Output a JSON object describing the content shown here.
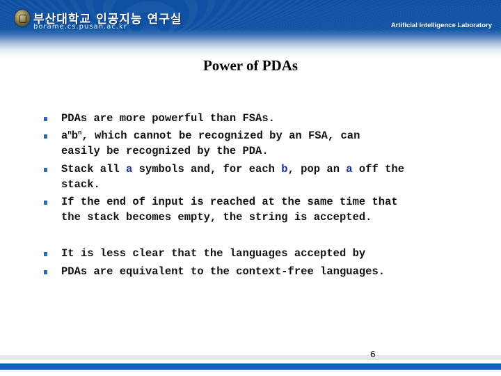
{
  "header": {
    "korean_title": "부산대학교 인공지능 연구실",
    "url": "borame.cs.pusan.ac.kr",
    "lab_name": "Artificial Intelligence Laboratory",
    "emblem": "university-emblem-icon"
  },
  "slide": {
    "title": "Power of PDAs",
    "bullets": [
      {
        "lines": [
          "PDAs are more powerful than FSAs."
        ]
      },
      {
        "pre": "a",
        "sup1": "n",
        "mid": "b",
        "sup2": "n",
        "lines": [
          ", which cannot be recognized by an FSA, can",
          "easily be recognized by the PDA."
        ]
      },
      {
        "parts": [
          "Stack all ",
          "a",
          " symbols and, for each ",
          "b",
          ", pop an ",
          "a",
          " off the"
        ],
        "line2": "stack."
      },
      {
        "lines": [
          "If the end of input is reached at the same time that",
          "the stack becomes empty, the string is accepted."
        ]
      },
      {
        "lines": [
          "It is less clear that the languages accepted by"
        ]
      },
      {
        "lines": [
          "PDAs are equivalent to the context-free languages."
        ]
      }
    ],
    "highlight_color": "#1a2fa0",
    "bullet_color": "#2b6db8",
    "page_number": "6"
  }
}
